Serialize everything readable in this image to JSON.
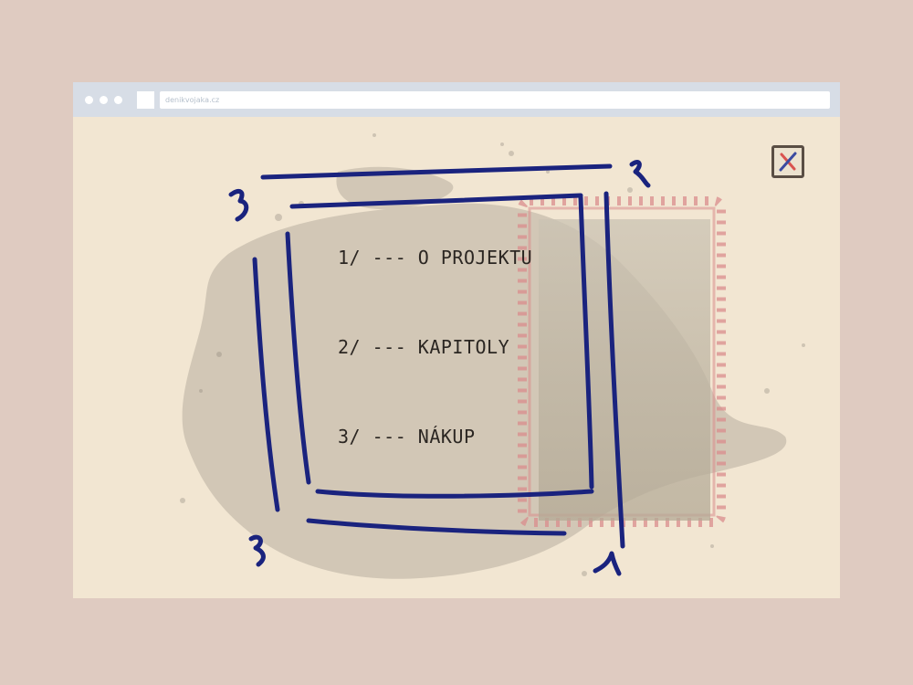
{
  "browser": {
    "url": "denikvojaka.cz"
  },
  "menu": {
    "items": [
      {
        "label": "1/ --- O PROJEKTU"
      },
      {
        "label": "2/ --- KAPITOLY"
      },
      {
        "label": "3/ --- NÁKUP"
      }
    ]
  },
  "icons": {
    "close": "close-x-icon"
  },
  "colors": {
    "page_background": "#dfcbc1",
    "titlebar": "#d7dde6",
    "paper": "#f2e6d2",
    "scribble_blue": "#1a237e",
    "stamp_red": "#d98c8c",
    "close_x_red": "#d9534f",
    "close_x_blue": "#3b4aa0"
  }
}
